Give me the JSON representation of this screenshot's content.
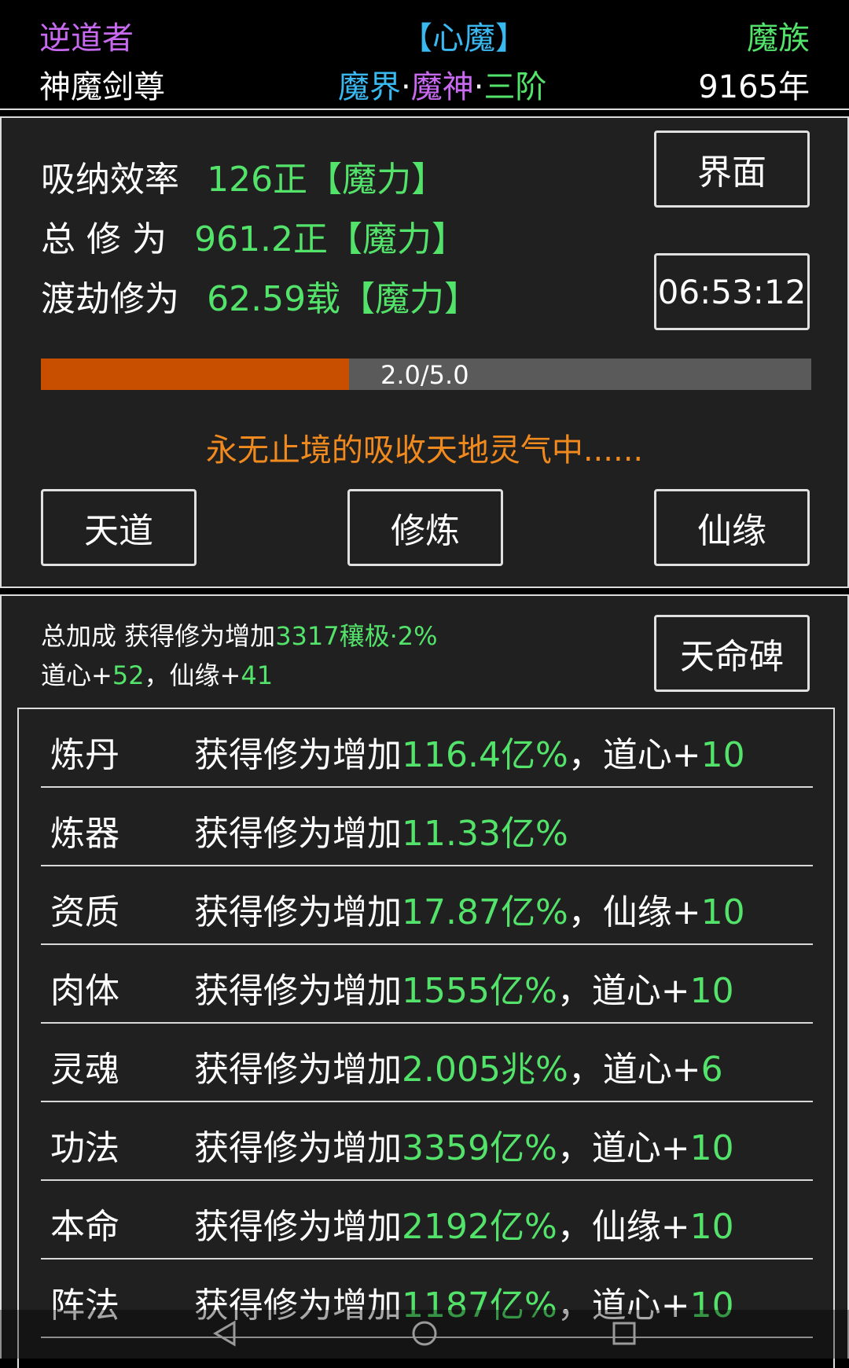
{
  "colors": {
    "green": "#54e36a",
    "purple": "#c86af0",
    "cyan": "#3ab8f0",
    "orange": "#f08a1e",
    "progress_fill": "#c84e00",
    "progress_track": "#5a5a5a"
  },
  "header": {
    "name": "逆道者",
    "title": "神魔剑尊",
    "mind_state": "【心魔】",
    "realm_world": "魔界",
    "realm_level": "魔神",
    "realm_stage": "三阶",
    "dot": "·",
    "race": "魔族",
    "age": "9165年"
  },
  "stats": {
    "absorb_label": "吸纳效率",
    "absorb_value": "126正",
    "absorb_unit": "【魔力】",
    "total_label": "总 修 为",
    "total_value": "961.2正",
    "total_unit": "【魔力】",
    "tribulation_label": "渡劫修为",
    "tribulation_value": "62.59载",
    "tribulation_unit": "【魔力】",
    "interface_button": "界面",
    "timer": "06:53:12",
    "progress_text": "2.0/5.0",
    "progress_fraction": 0.4,
    "status_message": "永无止境的吸收天地灵气中......"
  },
  "actions": {
    "tiandao": "天道",
    "cultivate": "修炼",
    "fate": "仙缘"
  },
  "bonus": {
    "line1_prefix": "总加成 获得修为增加",
    "line1_value": "3317穰极·2%",
    "line2_a": "道心+",
    "line2_a_val": "52",
    "line2_sep": "，仙缘+",
    "line2_b_val": "41",
    "stele_button": "天命碑"
  },
  "rows": [
    {
      "name": "炼丹",
      "prefix": "获得修为增加",
      "value": "116.4亿%",
      "extra_label": "，道心+",
      "extra_value": "10"
    },
    {
      "name": "炼器",
      "prefix": "获得修为增加",
      "value": "11.33亿%",
      "extra_label": "",
      "extra_value": ""
    },
    {
      "name": "资质",
      "prefix": "获得修为增加",
      "value": "17.87亿%",
      "extra_label": "，仙缘+",
      "extra_value": "10"
    },
    {
      "name": "肉体",
      "prefix": "获得修为增加",
      "value": "1555亿%",
      "extra_label": "，道心+",
      "extra_value": "10"
    },
    {
      "name": "灵魂",
      "prefix": "获得修为增加",
      "value": "2.005兆%",
      "extra_label": "，道心+",
      "extra_value": "6"
    },
    {
      "name": "功法",
      "prefix": "获得修为增加",
      "value": "3359亿%",
      "extra_label": "，道心+",
      "extra_value": "10"
    },
    {
      "name": "本命",
      "prefix": "获得修为增加",
      "value": "2192亿%",
      "extra_label": "，仙缘+",
      "extra_value": "10"
    },
    {
      "name": "阵法",
      "prefix": "获得修为增加",
      "value": "1187亿%",
      "extra_label": "，道心+",
      "extra_value": "10"
    }
  ],
  "navbar": {
    "back": "back-icon",
    "home": "home-icon",
    "recents": "recents-icon"
  }
}
